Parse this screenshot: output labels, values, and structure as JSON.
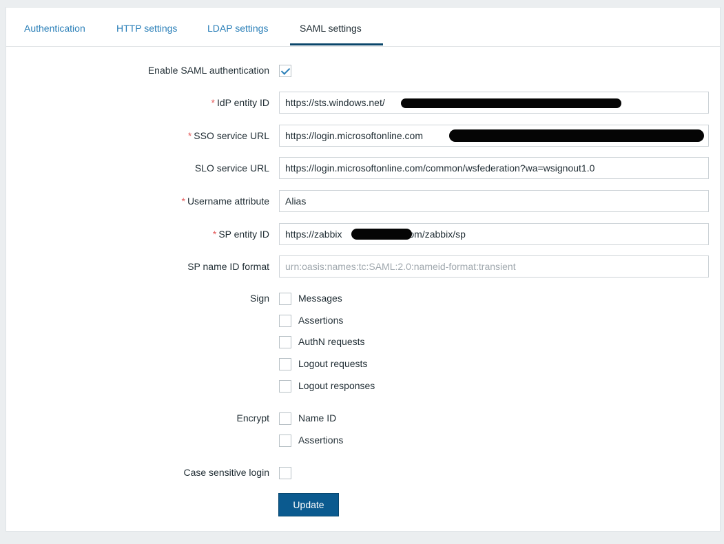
{
  "tabs": [
    {
      "label": "Authentication",
      "active": false
    },
    {
      "label": "HTTP settings",
      "active": false
    },
    {
      "label": "LDAP settings",
      "active": false
    },
    {
      "label": "SAML settings",
      "active": true
    }
  ],
  "form": {
    "enable_saml": {
      "label": "Enable SAML authentication",
      "checked": true
    },
    "idp_entity_id": {
      "label": "IdP entity ID",
      "required": "*",
      "value": "https://sts.windows.net/"
    },
    "sso_service_url": {
      "label": "SSO service URL",
      "required": "*",
      "value": "https://login.microsoftonline.com"
    },
    "slo_service_url": {
      "label": "SLO service URL",
      "value": "https://login.microsoftonline.com/common/wsfederation?wa=wsignout1.0"
    },
    "username_attribute": {
      "label": "Username attribute",
      "required": "*",
      "value": "Alias"
    },
    "sp_entity_id": {
      "label": "SP entity ID",
      "required": "*",
      "value_prefix": "https://zabbix",
      "value_suffix": ".com/zabbix/sp"
    },
    "sp_name_id_format": {
      "label": "SP name ID format",
      "placeholder": "urn:oasis:names:tc:SAML:2.0:nameid-format:transient"
    },
    "sign": {
      "label": "Sign",
      "options": [
        {
          "label": "Messages",
          "checked": false
        },
        {
          "label": "Assertions",
          "checked": false
        },
        {
          "label": "AuthN requests",
          "checked": false
        },
        {
          "label": "Logout requests",
          "checked": false
        },
        {
          "label": "Logout responses",
          "checked": false
        }
      ]
    },
    "encrypt": {
      "label": "Encrypt",
      "options": [
        {
          "label": "Name ID",
          "checked": false
        },
        {
          "label": "Assertions",
          "checked": false
        }
      ]
    },
    "case_sensitive_login": {
      "label": "Case sensitive login",
      "checked": false
    },
    "update_label": "Update"
  },
  "colors": {
    "link": "#2a7fb8",
    "active_tab_underline": "#0a466a",
    "button": "#0b5a8f",
    "required": "#e45959",
    "redaction": "#050505"
  }
}
